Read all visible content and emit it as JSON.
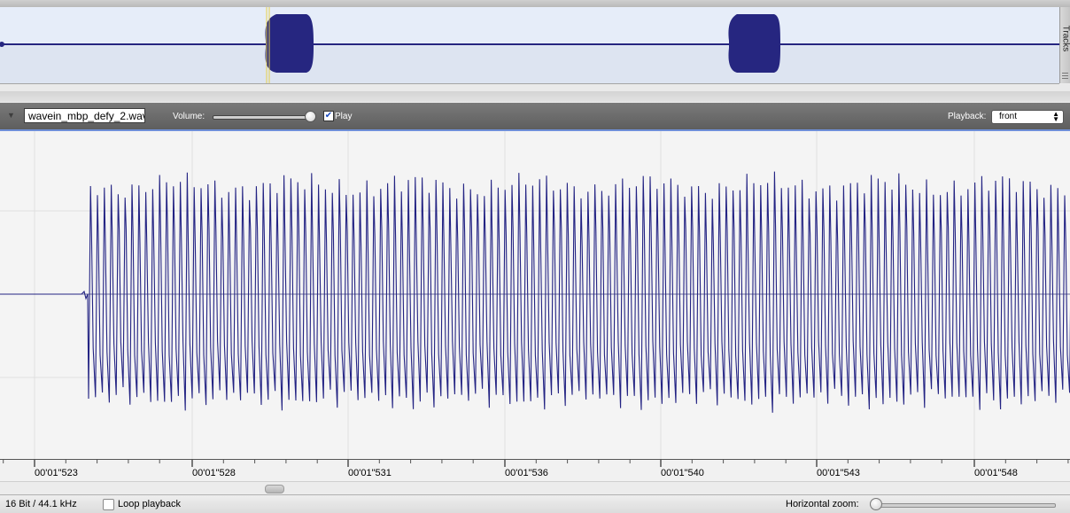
{
  "overview": {
    "tracks_label": "Tracks",
    "wave_color": "#262680",
    "cursor_color": "#e8d14a"
  },
  "toolbar": {
    "filename": "wavein_mbp_defy_2.wav",
    "volume_label": "Volume:",
    "volume_level": 0.98,
    "play_checked": true,
    "play_label": "Play",
    "playback_label": "Playback:",
    "playback_value": "front"
  },
  "waveform": {
    "line_color": "#232383",
    "background": "#f4f4f4"
  },
  "ruler": {
    "ticks": [
      "00'01\"523",
      "00'01\"528",
      "00'01\"531",
      "00'01\"536",
      "00'01\"540",
      "00'01\"543",
      "00'01\"548"
    ]
  },
  "status": {
    "format": "16 Bit / 44.1 kHz",
    "loop_label": "Loop playback",
    "loop_checked": false,
    "hzoom_label": "Horizontal zoom:",
    "hzoom_level": 0.0
  }
}
